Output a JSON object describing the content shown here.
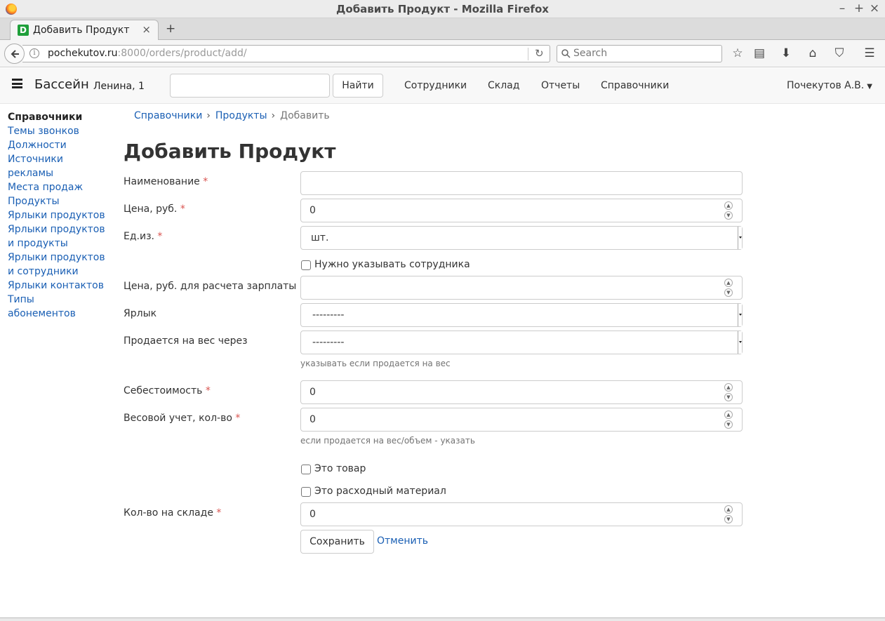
{
  "window": {
    "title": "Добавить Продукт - Mozilla Firefox",
    "minimize": "–",
    "maximize": "+",
    "close": "×"
  },
  "tab": {
    "favicon": "D",
    "label": "Добавить Продукт",
    "close": "×",
    "new_tab": "+"
  },
  "urlbar": {
    "host": "pochekutov.ru",
    "rest": ":8000/orders/product/add/",
    "reload": "↻"
  },
  "searchbar": {
    "placeholder": "Search",
    "icon": "search-icon"
  },
  "toolbar": {
    "bookmark": "☆",
    "reader": "▤",
    "download": "⬇",
    "home": "⌂",
    "pocket": "⛉",
    "menu": "☰"
  },
  "site": {
    "brand": "Бассейн",
    "brand_sub": "Ленина, 1",
    "search_value": "",
    "find_label": "Найти",
    "nav": [
      "Сотрудники",
      "Склад",
      "Отчеты",
      "Справочники"
    ],
    "user": "Почекутов А.В.",
    "user_caret": "▼"
  },
  "sidebar": {
    "heading": "Справочники",
    "items": [
      "Темы звонков",
      "Должности",
      "Источники рекламы",
      "Места продаж",
      "Продукты",
      "Ярлыки продуктов",
      "Ярлыки продуктов и продукты",
      "Ярлыки продуктов и сотрудники",
      "Ярлыки контактов",
      "Типы абонементов"
    ]
  },
  "breadcrumb": {
    "items": [
      "Справочники",
      "Продукты"
    ],
    "active": "Добавить",
    "sep": "›"
  },
  "page_title": "Добавить Продукт",
  "form": {
    "name_label": "Наименование",
    "name_value": "",
    "price_label": "Цена, руб.",
    "price_value": "0",
    "unit_label": "Ед.из.",
    "unit_value": "шт.",
    "need_employee_label": "Нужно указывать сотрудника",
    "salary_price_label": "Цена, руб. для расчета зарплаты",
    "salary_price_value": "",
    "tag_label": "Ярлык",
    "tag_value": "---------",
    "sold_by_weight_label": "Продается на вес через",
    "sold_by_weight_value": "---------",
    "sold_by_weight_help": "указывать если продается на вес",
    "cost_label": "Себестоимость",
    "cost_value": "0",
    "weight_label": "Весовой учет, кол-во",
    "weight_value": "0",
    "weight_help": "если продается на вес/объем - указать",
    "is_goods_label": "Это товар",
    "is_consumable_label": "Это расходный материал",
    "stock_label": "Кол-во на складе",
    "stock_value": "0",
    "required_mark": "*",
    "save_label": "Сохранить",
    "cancel_label": "Отменить"
  }
}
